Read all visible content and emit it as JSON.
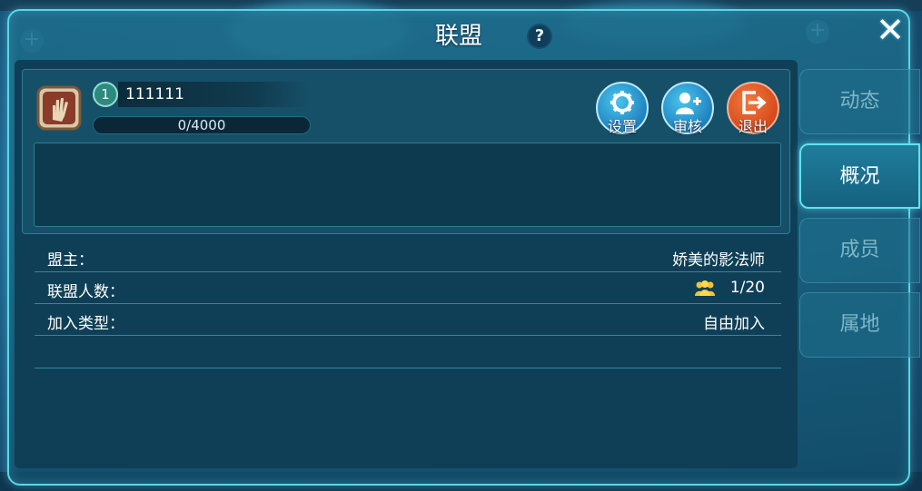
{
  "window": {
    "title": "联盟",
    "help_label": "?",
    "close_label": "✕"
  },
  "alliance": {
    "level": "1",
    "name": "111111",
    "exp_text": "0/4000",
    "exp_fraction": 0.0,
    "notice": ""
  },
  "actions": [
    {
      "label": "设置",
      "icon": "gear-icon",
      "color": "#1f83c0"
    },
    {
      "label": "审核",
      "icon": "user-add-icon",
      "color": "#1f83c0"
    },
    {
      "label": "退出",
      "icon": "exit-icon",
      "color": "#d64a1c"
    }
  ],
  "info": [
    {
      "key": "盟主：",
      "value": "娇美的影法师"
    },
    {
      "key": "联盟人数：",
      "value": "1/20",
      "icon": "members-icon"
    },
    {
      "key": "加入类型：",
      "value": "自由加入"
    }
  ],
  "tabs": [
    {
      "label": "动态",
      "active": false
    },
    {
      "label": "概况",
      "active": true
    },
    {
      "label": "成员",
      "active": false
    },
    {
      "label": "属地",
      "active": false
    }
  ],
  "colors": {
    "accent": "#5fe2f0",
    "panel": "#0f3f56",
    "exit_button": "#d64a1c",
    "action_button": "#1f83c0"
  }
}
